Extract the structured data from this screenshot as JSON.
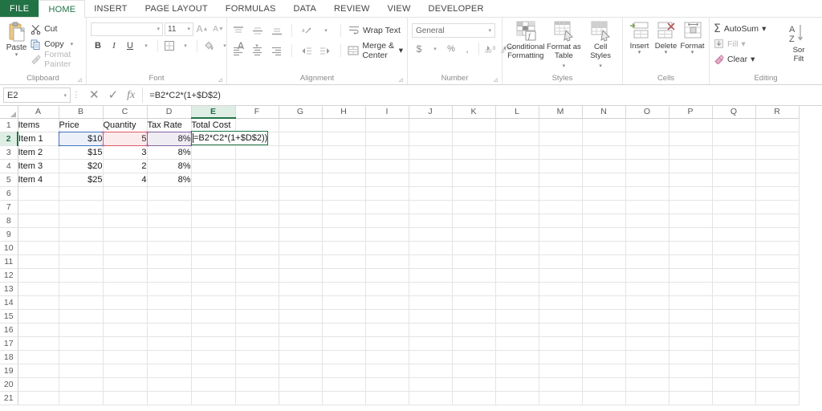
{
  "app": {
    "accent": "#217346",
    "tabs": [
      {
        "label": "FILE",
        "active": false,
        "file": true
      },
      {
        "label": "HOME",
        "active": true
      },
      {
        "label": "INSERT",
        "active": false
      },
      {
        "label": "PAGE LAYOUT",
        "active": false
      },
      {
        "label": "FORMULAS",
        "active": false
      },
      {
        "label": "DATA",
        "active": false
      },
      {
        "label": "REVIEW",
        "active": false
      },
      {
        "label": "VIEW",
        "active": false
      },
      {
        "label": "DEVELOPER",
        "active": false
      }
    ]
  },
  "ribbon": {
    "clipboard": {
      "group_label": "Clipboard",
      "paste_label": "Paste",
      "cut_label": "Cut",
      "copy_label": "Copy",
      "format_painter_label": "Format Painter"
    },
    "font": {
      "group_label": "Font",
      "font_name_value": "",
      "font_size_value": "11",
      "grow_font_label": "A",
      "shrink_font_label": "A",
      "bold_label": "B",
      "italic_label": "I",
      "underline_label": "U",
      "font_color_label": "A"
    },
    "alignment": {
      "group_label": "Alignment",
      "wrap_text_label": "Wrap Text",
      "merge_center_label": "Merge & Center"
    },
    "number": {
      "group_label": "Number",
      "format_value": "General",
      "currency_label": "$",
      "percent_label": "%",
      "comma_label": ","
    },
    "styles": {
      "group_label": "Styles",
      "conditional_formatting_label": "Conditional Formatting",
      "format_as_table_label": "Format as Table",
      "cell_styles_label": "Cell Styles"
    },
    "cells": {
      "group_label": "Cells",
      "insert_label": "Insert",
      "delete_label": "Delete",
      "format_label": "Format"
    },
    "editing": {
      "group_label": "Editing",
      "autosum_label": "AutoSum",
      "fill_label": "Fill",
      "clear_label": "Clear",
      "sort_line1": "Sor",
      "sort_line2": "Filt"
    }
  },
  "formula_bar": {
    "name_box_value": "E2",
    "cancel_label": "✕",
    "enter_label": "✓",
    "function_label": "fx",
    "formula_value": "=B2*C2*(1+$D$2)"
  },
  "grid": {
    "columns": [
      "A",
      "B",
      "C",
      "D",
      "E",
      "F",
      "G",
      "H",
      "I",
      "J",
      "K",
      "L",
      "M",
      "N",
      "O",
      "P",
      "Q",
      "R"
    ],
    "active_column": "E",
    "active_row": 2,
    "rows": [
      1,
      2,
      3,
      4,
      5,
      6,
      7,
      8,
      9,
      10,
      11,
      12,
      13,
      14,
      15,
      16,
      17,
      18,
      19,
      20,
      21
    ],
    "cells": {
      "A1": "Items",
      "B1": "Price",
      "C1": "Quantity",
      "D1": "Tax Rate",
      "E1": "Total Cost",
      "A2": "Item 1",
      "B2": "$10",
      "C2": "5",
      "D2": "8%",
      "A3": "Item 2",
      "B3": "$15",
      "C3": "3",
      "D3": "8%",
      "A4": "Item 3",
      "B4": "$20",
      "C4": "2",
      "D4": "8%",
      "A5": "Item 4",
      "B5": "$25",
      "C5": "4",
      "D5": "8%"
    },
    "editing_cell": "E2",
    "editing_text": "=B2*C2*(1+$D$2))",
    "reference_highlights": [
      {
        "cell": "B2",
        "color": "#4472c4",
        "name": "blue"
      },
      {
        "cell": "C2",
        "color": "#e05a6a",
        "name": "red"
      },
      {
        "cell": "D2",
        "color": "#8064a2",
        "name": "purple"
      }
    ]
  }
}
